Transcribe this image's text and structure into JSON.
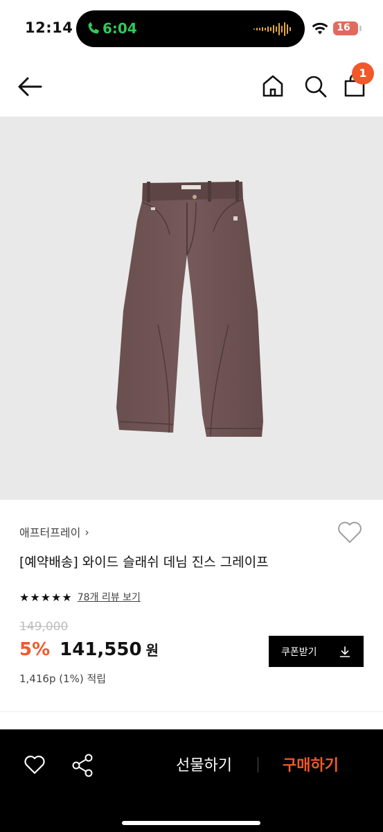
{
  "status_bar": {
    "time": "12:14",
    "call_time": "6:04",
    "battery": "16",
    "icons": [
      "phone-icon",
      "audio-wave-icon",
      "wifi-icon",
      "battery-icon"
    ]
  },
  "nav": {
    "icons": [
      "back-arrow-icon",
      "home-icon",
      "search-icon",
      "shopping-bag-icon"
    ],
    "cart_count": "1"
  },
  "product": {
    "brand": "애프터프레이",
    "title": "[예약배송] 와이드 슬래쉬 데님 진스 그레이프",
    "rating_stars": 5,
    "review_link": "78개 리뷰 보기",
    "original_price": "149,000",
    "discount": "5%",
    "price": "141,550",
    "currency": "원",
    "points": "1,416p (1%) 적립",
    "coupon_label": "쿠폰받기"
  },
  "bottom_bar": {
    "gift_label": "선물하기",
    "buy_label": "구매하기"
  },
  "colors": {
    "accent": "#f0592a",
    "call_green": "#34c759",
    "battery": "#e06a5f",
    "pants": "#6e5352"
  }
}
